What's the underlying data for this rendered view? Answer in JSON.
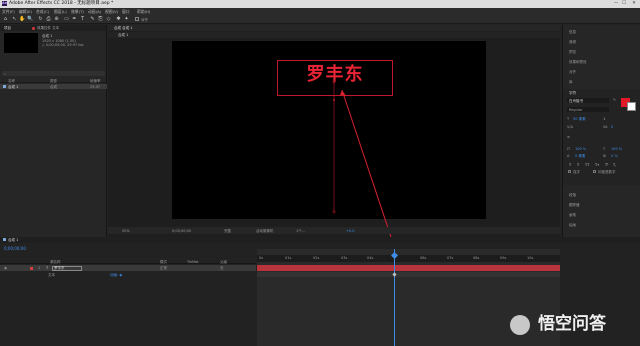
{
  "window": {
    "title": "Adobe After Effects CC 2018 - 无标题项目.aep *",
    "minimize": "—",
    "maximize": "☐",
    "close": "✕"
  },
  "menu": [
    "文件(F)",
    "编辑(E)",
    "合成(C)",
    "图层(L)",
    "效果(T)",
    "动画(A)",
    "视图(V)",
    "窗口",
    "帮助(H)"
  ],
  "toolbar": {
    "snap_label": "对齐",
    "icons": [
      "home-icon",
      "selection-icon",
      "hand-icon",
      "zoom-icon",
      "rotate-icon",
      "camera-icon",
      "pan-behind-icon",
      "rectangle-icon",
      "pen-icon",
      "type-icon",
      "brush-icon",
      "clone-stamp-icon",
      "eraser-icon",
      "roto-brush-icon",
      "puppet-icon"
    ],
    "glyphs": [
      "⌂",
      "↖",
      "✋",
      "🔍",
      "↻",
      "⎙",
      "⊕",
      "▭",
      "✒",
      "T",
      "✎",
      "⎘",
      "◇",
      "✱",
      "✦"
    ]
  },
  "project_panel": {
    "tab_label": "项目",
    "effects_tab": "效果控件 文本",
    "comp_name": "合成 1",
    "comp_info_lines": [
      "1920 x 1080 (1.00)",
      "△ 0;00;05;00, 29.97 fps"
    ],
    "col_name": "名称",
    "col_type": "类型",
    "col_size": "帧速率",
    "item_name": "合成 1",
    "item_type": "合成",
    "item_rate": "29.97"
  },
  "viewer": {
    "tab_label": "合成 合成 1",
    "breadcrumb": "合成 1",
    "comp_text": "罗丰东",
    "zoom": "50%",
    "timecode": "0;00;00;00",
    "resolution": "完整",
    "camera": "活动摄像机",
    "views": "1个...",
    "exposure": "+0.0"
  },
  "right_panel": {
    "items": [
      "信息",
      "音频",
      "预览",
      "效果和预设",
      "对齐",
      "库"
    ],
    "char_title": "字符",
    "font_name": "白舟楷书",
    "font_style": "Regular",
    "font_size": "50 像素",
    "tracking": "0",
    "scale_h": "100 %",
    "scale_v": "100 %",
    "baseline": "0 像素",
    "tsume": "0 %",
    "styles": [
      "T",
      "T",
      "TT",
      "Tт",
      "T¹",
      "T,"
    ],
    "options": [
      "连字",
      "印度语数字"
    ],
    "bottom_items": [
      "段落",
      "跟踪器",
      "画笔",
      "绘画"
    ],
    "fill_color": "#e01a24",
    "stroke_color": "#ffffff"
  },
  "timeline": {
    "tab_label": "合成 1",
    "timecode": "0;00;00;00",
    "col_source": "源名称",
    "col_mode": "模式",
    "col_trkmat": "TrkMat",
    "col_parent": "父级",
    "layer_number": "1",
    "layer_name": "罗丰东",
    "layer_mode": "正常",
    "parent_value": "无",
    "sub_property": "文本",
    "sub_value": "动画: ◉",
    "ruler_labels": [
      "0s",
      "01s",
      "02s",
      "03s",
      "04s",
      "05s",
      "06s",
      "07s",
      "08s",
      "09s",
      "10s"
    ],
    "toggle_label": "切换开关/模式"
  },
  "watermark": {
    "text": "悟空问答"
  },
  "colors": {
    "accent_blue": "#3f8ce8",
    "layer_red": "#b8343d",
    "annotation_red": "#d4222f"
  }
}
